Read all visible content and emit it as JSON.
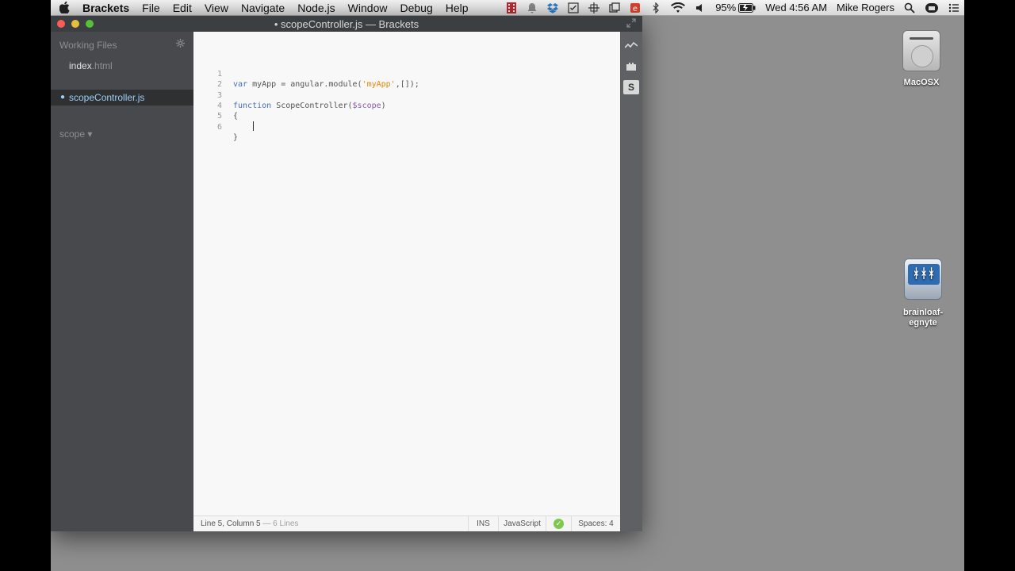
{
  "menubar": {
    "app_name": "Brackets",
    "items": [
      "File",
      "Edit",
      "View",
      "Navigate",
      "Node.js",
      "Window",
      "Debug",
      "Help"
    ],
    "battery": "95%",
    "clock": "Wed 4:56 AM",
    "user": "Mike Rogers"
  },
  "window": {
    "title": "• scopeController.js — Brackets"
  },
  "sidebar": {
    "working_files_label": "Working Files",
    "files": [
      {
        "name": "index",
        "ext": ".html"
      },
      {
        "name": "scopeController",
        "ext": ".js"
      }
    ],
    "project_label": "scope ▾"
  },
  "editor": {
    "line_numbers": [
      "1",
      "2",
      "3",
      "4",
      "5",
      "6"
    ],
    "lines": {
      "l1_kw": "var",
      "l1_rest_a": " myApp = angular.module(",
      "l1_str": "'myApp'",
      "l1_rest_b": ",[]);",
      "l3_kw": "function",
      "l3_fn": " ScopeController(",
      "l3_param": "$scope",
      "l3_close": ")",
      "l4": "{",
      "l6": "}"
    }
  },
  "statusbar": {
    "position": "Line 5, Column 5",
    "lines": " — 6 Lines",
    "mode": "INS",
    "language": "JavaScript",
    "lint": "✓",
    "spaces_label": "Spaces:",
    "spaces_value": "4"
  },
  "toolbar": {
    "s_label": "S"
  },
  "desktop": {
    "icons": [
      {
        "label": "MacOSX"
      },
      {
        "label": "brainloaf-egnyte"
      }
    ]
  }
}
